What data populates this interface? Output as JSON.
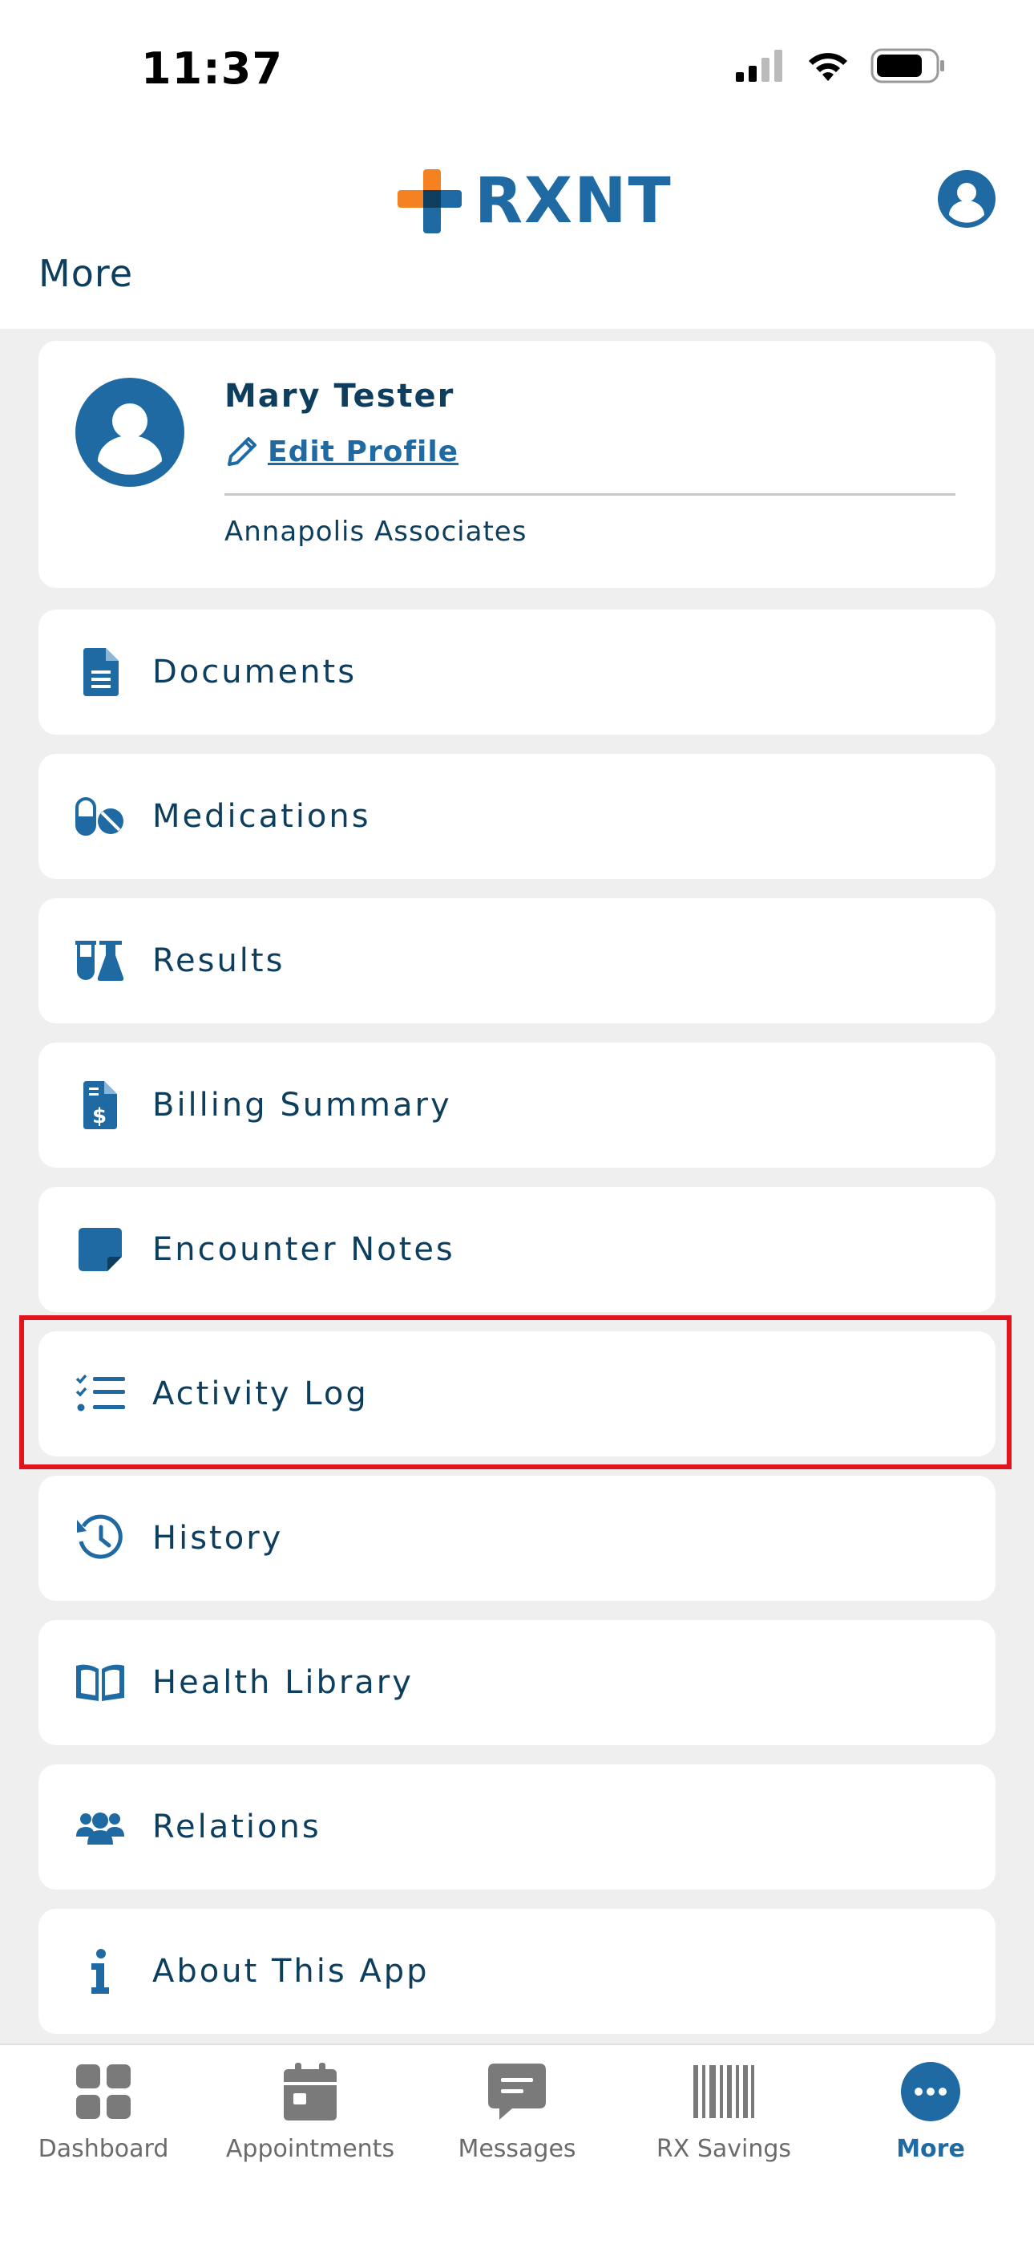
{
  "status_bar": {
    "time": "11:37"
  },
  "header": {
    "brand": "RXNT",
    "page_title": "More"
  },
  "profile": {
    "name": "Mary Tester",
    "edit_label": "Edit Profile",
    "organization": "Annapolis Associates"
  },
  "menu": {
    "items": [
      {
        "label": "Documents",
        "icon": "document-icon"
      },
      {
        "label": "Medications",
        "icon": "pills-icon"
      },
      {
        "label": "Results",
        "icon": "lab-flask-icon"
      },
      {
        "label": "Billing Summary",
        "icon": "invoice-dollar-icon"
      },
      {
        "label": "Encounter Notes",
        "icon": "sticky-note-icon"
      },
      {
        "label": "Activity Log",
        "icon": "checklist-icon",
        "highlighted": true
      },
      {
        "label": "History",
        "icon": "history-icon"
      },
      {
        "label": "Health Library",
        "icon": "book-icon"
      },
      {
        "label": "Relations",
        "icon": "users-icon"
      },
      {
        "label": "About This App",
        "icon": "info-icon"
      }
    ]
  },
  "tabbar": {
    "tabs": [
      {
        "label": "Dashboard",
        "icon": "dashboard-grid-icon"
      },
      {
        "label": "Appointments",
        "icon": "calendar-icon"
      },
      {
        "label": "Messages",
        "icon": "message-icon"
      },
      {
        "label": "RX Savings",
        "icon": "barcode-icon"
      },
      {
        "label": "More",
        "icon": "more-dots-icon",
        "active": true
      }
    ]
  },
  "colors": {
    "primary": "#1f6aa3",
    "text": "#0d3e5e",
    "background": "#efefef",
    "highlight": "#e0141f",
    "logo_orange": "#f58220"
  }
}
